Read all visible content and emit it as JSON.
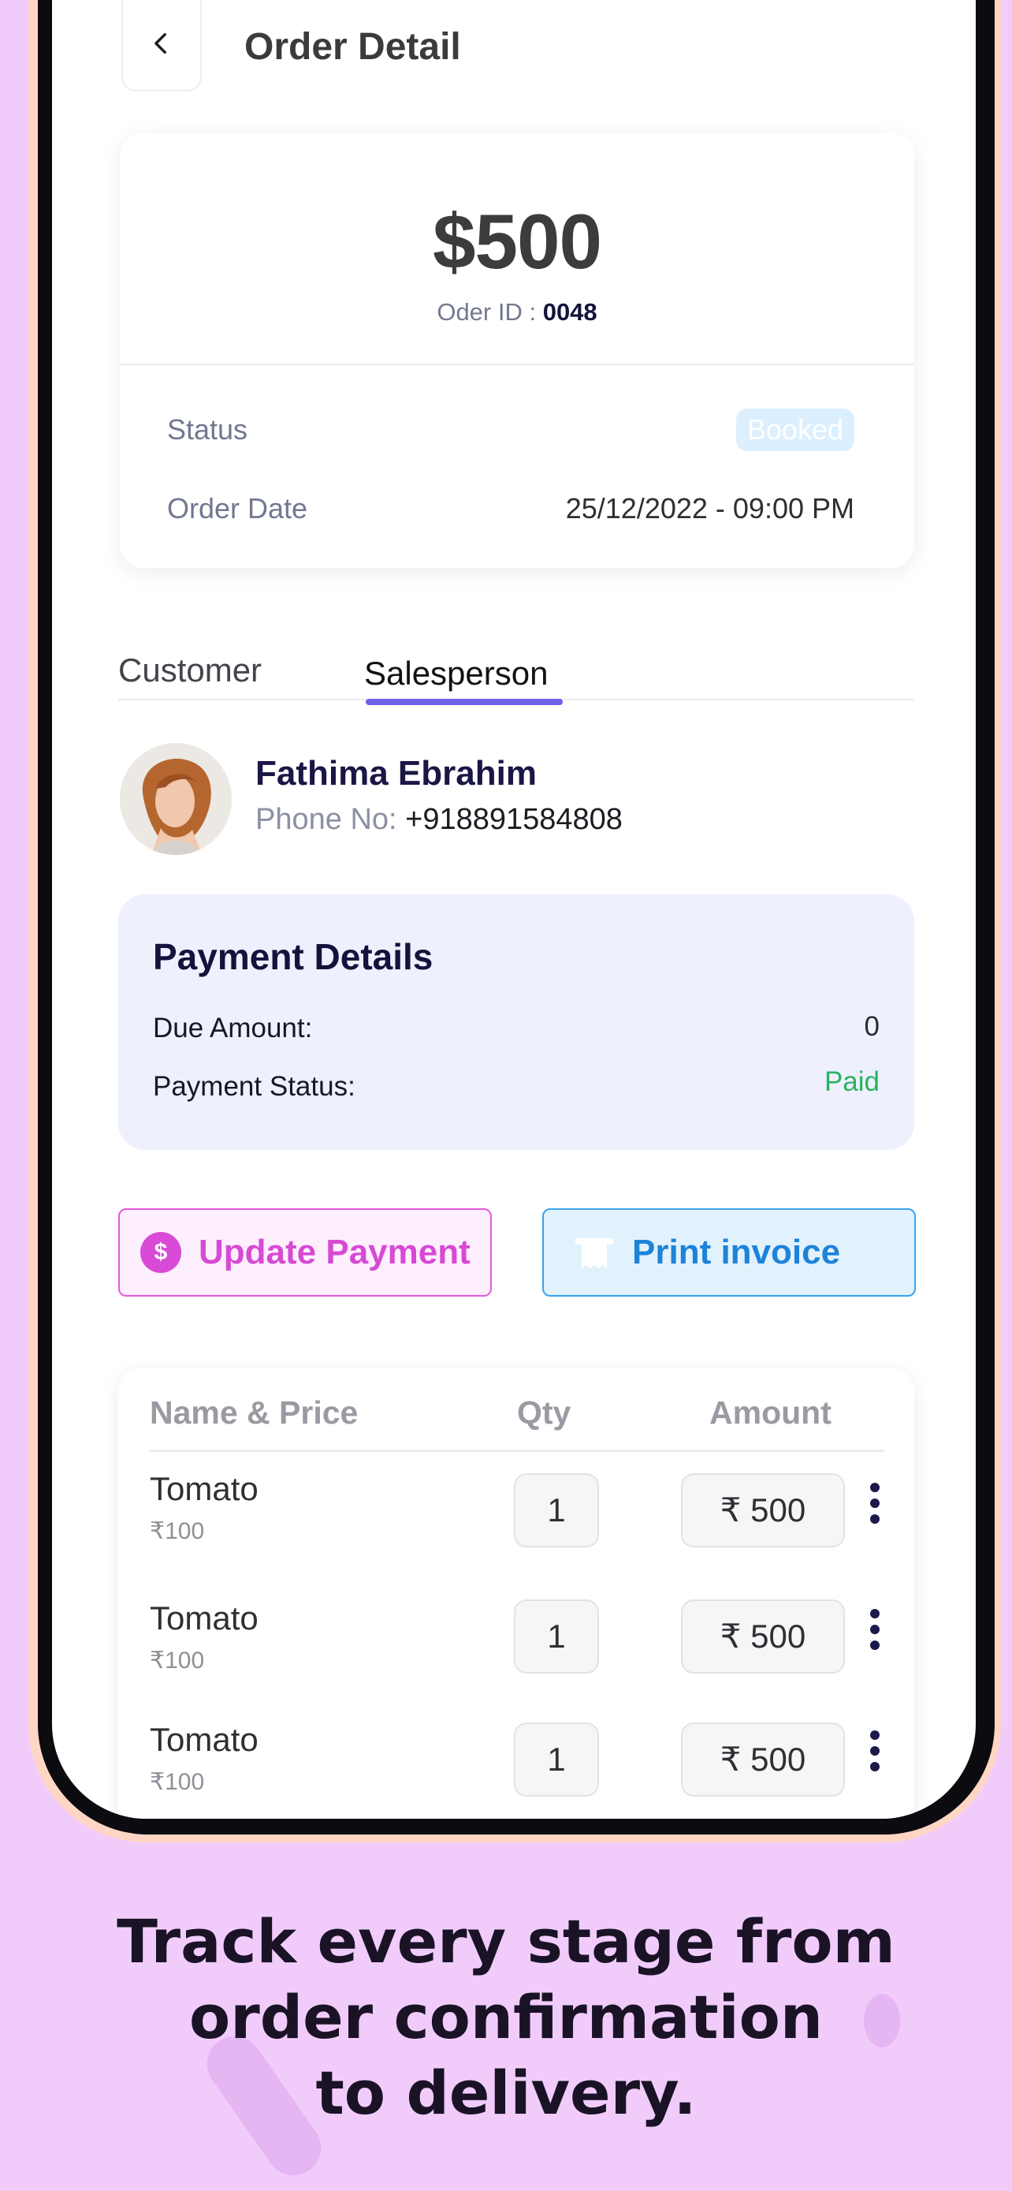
{
  "header": {
    "title": "Order Detail"
  },
  "summary": {
    "amount": "$500",
    "order_id_label": "Oder ID : ",
    "order_id_value": "0048",
    "status_label": "Status",
    "status_value": "Booked",
    "order_date_label": "Order Date",
    "order_date_value": "25/12/2022 - 09:00 PM"
  },
  "tabs": [
    {
      "label": "Customer",
      "active": false
    },
    {
      "label": "Salesperson",
      "active": true
    }
  ],
  "person": {
    "name": "Fathima Ebrahim",
    "phone_label": "Phone No: ",
    "phone_value": "+918891584808"
  },
  "payment": {
    "title": "Payment Details",
    "due_label": "Due Amount:",
    "due_value": "0",
    "status_label": "Payment Status:",
    "status_value": "Paid",
    "status_color": "#29b35f"
  },
  "actions": {
    "update_label": "Update Payment",
    "update_icon": "dollar-icon",
    "print_label": "Print invoice",
    "print_icon": "receipt-icon"
  },
  "table": {
    "headers": [
      "Name & Price",
      "Qty",
      "Amount"
    ],
    "rows": [
      {
        "name": "Tomato",
        "price": "₹100",
        "qty": "1",
        "amount": "₹ 500"
      },
      {
        "name": "Tomato",
        "price": "₹100",
        "qty": "1",
        "amount": "₹ 500"
      },
      {
        "name": "Tomato",
        "price": "₹100",
        "qty": "1",
        "amount": "₹ 500"
      }
    ]
  },
  "headline": {
    "line1": "Track every stage from",
    "line2": "order confirmation",
    "line3": "to delivery."
  },
  "colors": {
    "background": "#f1ccfb",
    "accent": "#6f62e8",
    "update_button": "#d64ad4",
    "print_button": "#1d83d9"
  }
}
